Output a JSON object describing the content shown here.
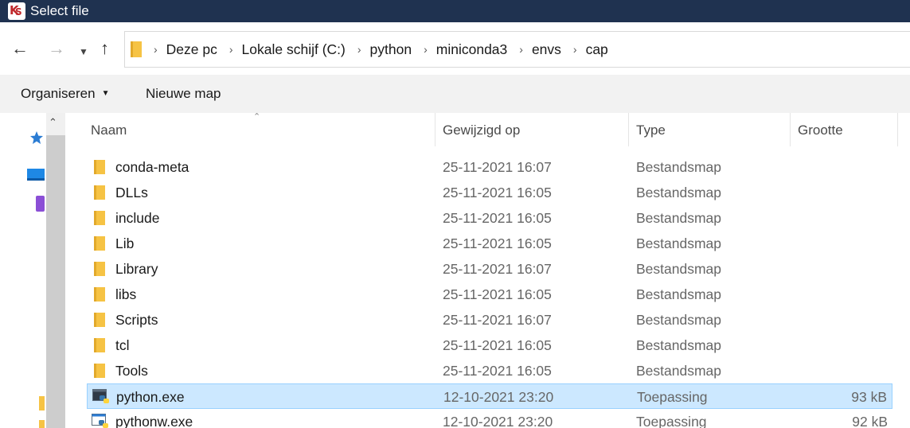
{
  "window": {
    "title": "Select file"
  },
  "nav": {
    "back": "←",
    "forward": "→",
    "recent": "⌄",
    "up": "↑"
  },
  "breadcrumbs": [
    "Deze pc",
    "Lokale schijf (C:)",
    "python",
    "miniconda3",
    "envs",
    "cap"
  ],
  "command_bar": {
    "organize": "Organiseren",
    "new_folder": "Nieuwe map"
  },
  "columns": {
    "name": "Naam",
    "modified": "Gewijzigd op",
    "type": "Type",
    "size": "Grootte"
  },
  "files": [
    {
      "name": "conda-meta",
      "modified": "25-11-2021 16:07",
      "type": "Bestandsmap",
      "size": "",
      "icon": "folder-icon"
    },
    {
      "name": "DLLs",
      "modified": "25-11-2021 16:05",
      "type": "Bestandsmap",
      "size": "",
      "icon": "folder-icon"
    },
    {
      "name": "include",
      "modified": "25-11-2021 16:05",
      "type": "Bestandsmap",
      "size": "",
      "icon": "folder-icon"
    },
    {
      "name": "Lib",
      "modified": "25-11-2021 16:05",
      "type": "Bestandsmap",
      "size": "",
      "icon": "folder-icon"
    },
    {
      "name": "Library",
      "modified": "25-11-2021 16:07",
      "type": "Bestandsmap",
      "size": "",
      "icon": "folder-icon"
    },
    {
      "name": "libs",
      "modified": "25-11-2021 16:05",
      "type": "Bestandsmap",
      "size": "",
      "icon": "folder-icon"
    },
    {
      "name": "Scripts",
      "modified": "25-11-2021 16:07",
      "type": "Bestandsmap",
      "size": "",
      "icon": "folder-icon"
    },
    {
      "name": "tcl",
      "modified": "25-11-2021 16:05",
      "type": "Bestandsmap",
      "size": "",
      "icon": "folder-icon"
    },
    {
      "name": "Tools",
      "modified": "25-11-2021 16:05",
      "type": "Bestandsmap",
      "size": "",
      "icon": "folder-icon"
    },
    {
      "name": "python.exe",
      "modified": "12-10-2021 23:20",
      "type": "Toepassing",
      "size": "93 kB",
      "icon": "python-console-icon",
      "selected": true
    },
    {
      "name": "pythonw.exe",
      "modified": "12-10-2021 23:20",
      "type": "Toepassing",
      "size": "92 kB",
      "icon": "python-window-icon"
    }
  ],
  "colors": {
    "titlebar": "#1f3250",
    "selection": "#cce8ff",
    "selection_border": "#99d1ff",
    "folder": "#f6c344"
  }
}
